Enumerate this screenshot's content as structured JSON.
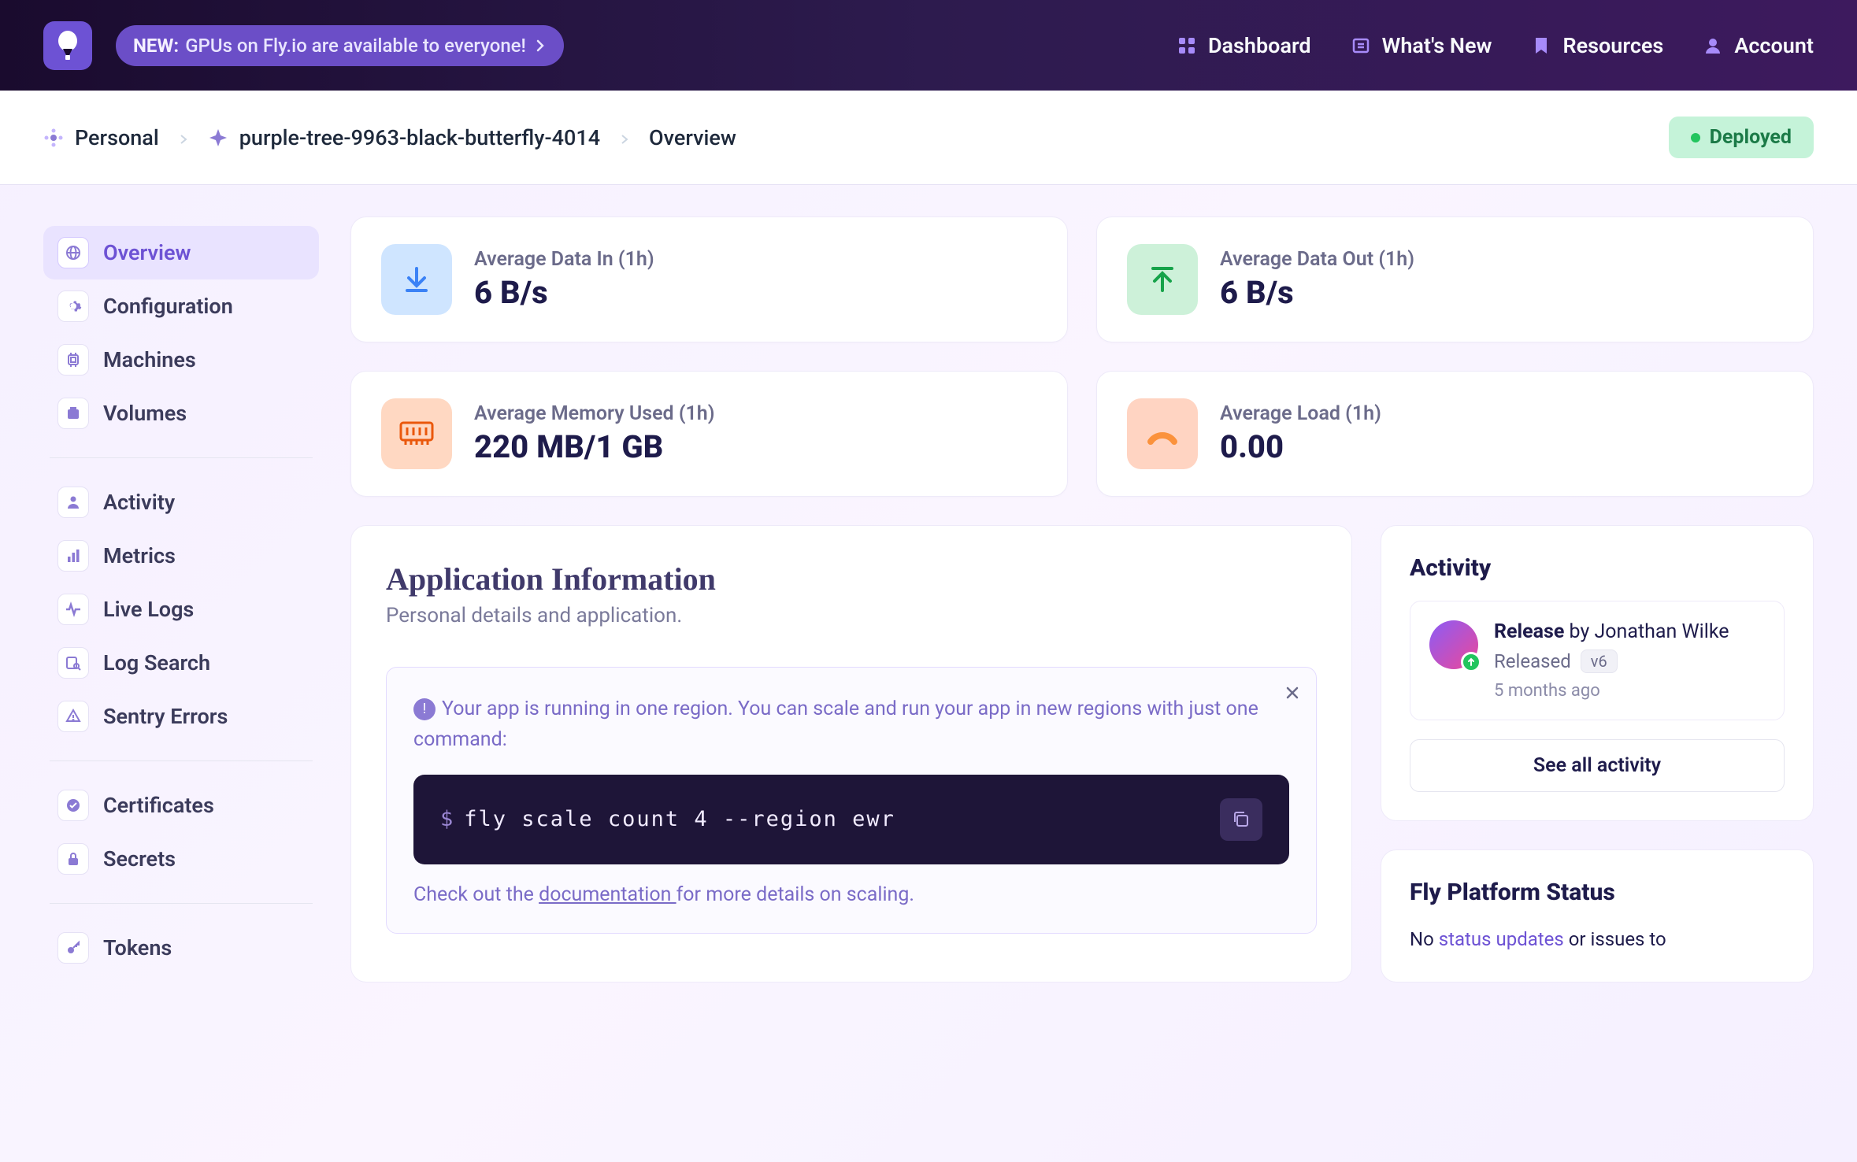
{
  "topbar": {
    "announce_new": "NEW:",
    "announce_text": "GPUs on Fly.io are available to everyone!",
    "nav": {
      "dashboard": "Dashboard",
      "whatsnew": "What's New",
      "resources": "Resources",
      "account": "Account"
    }
  },
  "breadcrumb": {
    "org": "Personal",
    "app": "purple-tree-9963-black-butterfly-4014",
    "page": "Overview",
    "status": "Deployed"
  },
  "sidebar": {
    "group1": [
      {
        "label": "Overview",
        "icon": "globe-icon",
        "active": true
      },
      {
        "label": "Configuration",
        "icon": "gear-icon"
      },
      {
        "label": "Machines",
        "icon": "cpu-icon"
      },
      {
        "label": "Volumes",
        "icon": "disk-icon"
      }
    ],
    "group2": [
      {
        "label": "Activity",
        "icon": "person-icon"
      },
      {
        "label": "Metrics",
        "icon": "chart-icon"
      },
      {
        "label": "Live Logs",
        "icon": "pulse-icon"
      },
      {
        "label": "Log Search",
        "icon": "search-icon"
      },
      {
        "label": "Sentry Errors",
        "icon": "error-icon"
      }
    ],
    "group3": [
      {
        "label": "Certificates",
        "icon": "check-icon"
      },
      {
        "label": "Secrets",
        "icon": "lock-icon"
      }
    ],
    "group4": [
      {
        "label": "Tokens",
        "icon": "key-icon"
      }
    ]
  },
  "stats": [
    {
      "label": "Average Data In (1h)",
      "value": "6 B/s",
      "color": "blue",
      "icon": "download-icon"
    },
    {
      "label": "Average Data Out (1h)",
      "value": "6 B/s",
      "color": "green",
      "icon": "upload-icon"
    },
    {
      "label": "Average Memory Used (1h)",
      "value": "220 MB/1 GB",
      "color": "orange",
      "icon": "memory-icon"
    },
    {
      "label": "Average Load (1h)",
      "value": "0.00",
      "color": "orange2",
      "icon": "gauge-icon"
    }
  ],
  "appinfo": {
    "title": "Application Information",
    "subtitle": "Personal details and application.",
    "tip_text": "Your app is running in one region. You can scale and run your app in new regions with just one command:",
    "code": "fly scale count 4 --region ewr",
    "footer_prefix": "Check out the ",
    "footer_link": "documentation ",
    "footer_suffix": "for more details on scaling."
  },
  "activity": {
    "title": "Activity",
    "item": {
      "action": "Release",
      "by": " by Jonathan Wilke",
      "status": "Released",
      "version": "v6",
      "time": "5 months ago"
    },
    "see_all": "See all activity"
  },
  "platform": {
    "title": "Fly Platform Status",
    "prefix": "No ",
    "link": "status updates",
    "suffix": " or issues to"
  }
}
